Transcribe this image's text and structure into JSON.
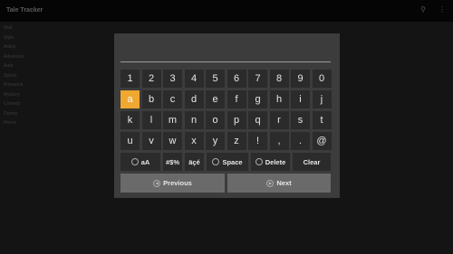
{
  "header": {
    "title": "Tale Tracker",
    "search_icon": "search-icon",
    "menu_icon": "more-vertical-icon"
  },
  "background_list": [
    "Mall",
    "Style",
    "Action",
    "Adventure",
    "Auto",
    "Sports",
    "Romance",
    "Mystery",
    "Comedy",
    "Drama",
    "Horror"
  ],
  "keyboard": {
    "input_value": "",
    "rows": [
      [
        "1",
        "2",
        "3",
        "4",
        "5",
        "6",
        "7",
        "8",
        "9",
        "0"
      ],
      [
        "a",
        "b",
        "c",
        "d",
        "e",
        "f",
        "g",
        "h",
        "i",
        "j"
      ],
      [
        "k",
        "l",
        "m",
        "n",
        "o",
        "p",
        "q",
        "r",
        "s",
        "t"
      ],
      [
        "u",
        "v",
        "w",
        "x",
        "y",
        "z",
        "!",
        ",",
        ".",
        "@"
      ]
    ],
    "focused_key": "a",
    "function_keys": {
      "case_glyph": "aA",
      "symbols": "#$%",
      "accents": "äçé",
      "space": "Space",
      "delete": "Delete",
      "clear": "Clear"
    },
    "previous_label": "Previous",
    "next_label": "Next"
  },
  "colors": {
    "focus": "#f0a830",
    "key": "#2b2b2b",
    "panel": "#3c3c3c",
    "nav_button": "#6a6a6a"
  }
}
